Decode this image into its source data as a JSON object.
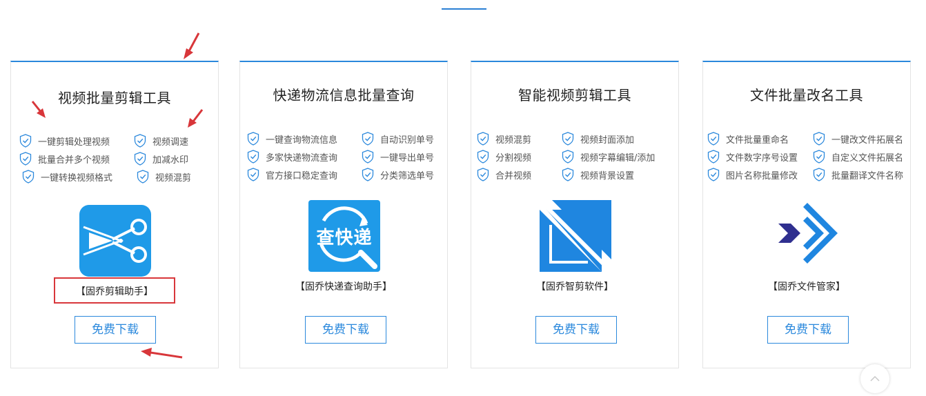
{
  "colors": {
    "accent": "#2a88dc",
    "annotation_red": "#d8363a"
  },
  "cards": [
    {
      "title": "视频批量剪辑工具",
      "features": [
        "一键剪辑处理视频",
        "视频调速",
        "批量合并多个视频",
        "加减水印",
        "一键转换视频格式",
        "视频混剪"
      ],
      "logo_icon": "scissors-icon",
      "product_name": "【固乔剪辑助手】",
      "download_label": "免费下载"
    },
    {
      "title": "快递物流信息批量查询",
      "features": [
        "一键查询物流信息",
        "自动识别单号",
        "多家快递物流查询",
        "一键导出单号",
        "官方接口稳定查询",
        "分类筛选单号"
      ],
      "logo_icon": "express-search-icon",
      "logo_text": "查快递",
      "product_name": "【固乔快递查询助手】",
      "download_label": "免费下载"
    },
    {
      "title": "智能视频剪辑工具",
      "features": [
        "视频混剪",
        "视频封面添加",
        "分割视频",
        "视频字幕编辑/添加",
        "合并视频",
        "视频背景设置"
      ],
      "logo_icon": "smart-cut-icon",
      "product_name": "【固乔智剪软件】",
      "download_label": "免费下载"
    },
    {
      "title": "文件批量改名工具",
      "features": [
        "文件批量重命名",
        "一键改文件拓展名",
        "文件数字序号设置",
        "自定义文件拓展名",
        "图片名称批量修改",
        "批量翻译文件名称"
      ],
      "logo_icon": "file-manager-icon",
      "product_name": "【固乔文件管家】",
      "download_label": "免费下载"
    }
  ]
}
